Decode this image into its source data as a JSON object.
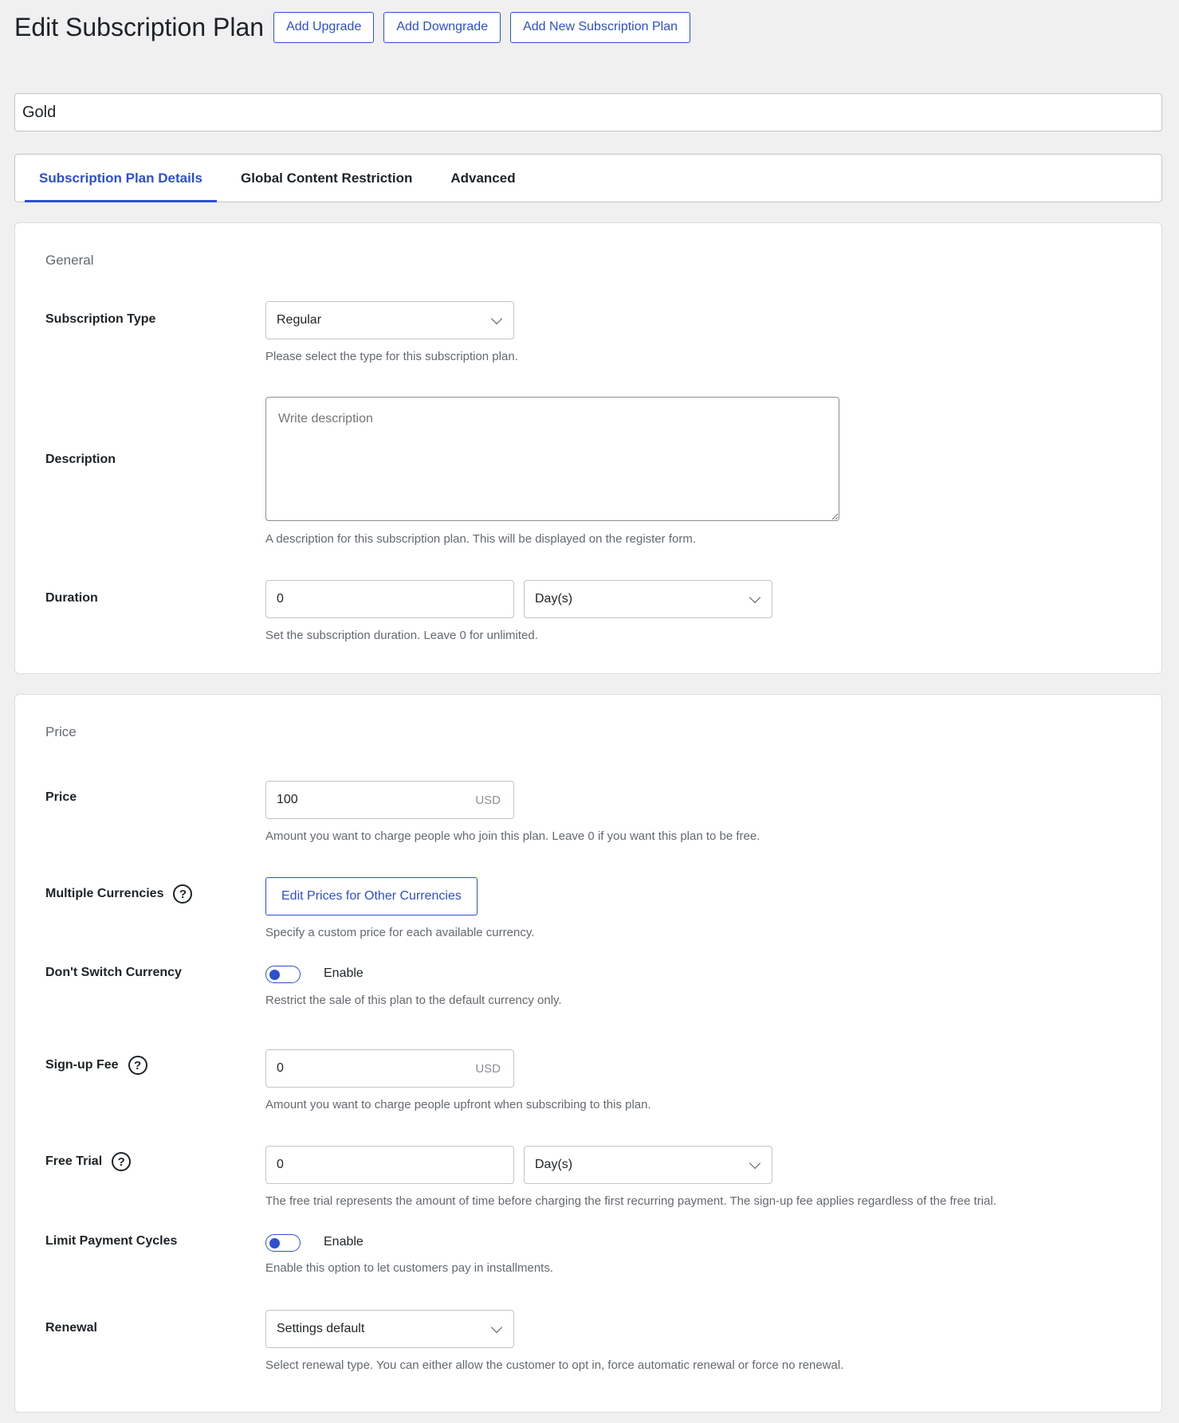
{
  "header": {
    "title": "Edit Subscription Plan",
    "buttons": [
      "Add Upgrade",
      "Add Downgrade",
      "Add New Subscription Plan"
    ]
  },
  "plan_name": "Gold",
  "tabs": [
    {
      "label": "Subscription Plan Details",
      "active": true
    },
    {
      "label": "Global Content Restriction",
      "active": false
    },
    {
      "label": "Advanced",
      "active": false
    }
  ],
  "general": {
    "section_title": "General",
    "subscription_type": {
      "label": "Subscription Type",
      "value": "Regular",
      "hint": "Please select the type for this subscription plan."
    },
    "description": {
      "label": "Description",
      "placeholder": "Write description",
      "hint": "A description for this subscription plan. This will be displayed on the register form."
    },
    "duration": {
      "label": "Duration",
      "value": "0",
      "unit": "Day(s)",
      "hint": "Set the subscription duration. Leave 0 for unlimited."
    }
  },
  "price_section": {
    "section_title": "Price",
    "price": {
      "label": "Price",
      "value": "100",
      "currency": "USD",
      "hint": "Amount you want to charge people who join this plan. Leave 0 if you want this plan to be free."
    },
    "multiple_currencies": {
      "label": "Multiple Currencies",
      "button": "Edit Prices for Other Currencies",
      "hint": "Specify a custom price for each available currency."
    },
    "dont_switch_currency": {
      "label": "Don't Switch Currency",
      "toggle_label": "Enable",
      "hint": "Restrict the sale of this plan to the default currency only."
    },
    "signup_fee": {
      "label": "Sign-up Fee",
      "value": "0",
      "currency": "USD",
      "hint": "Amount you want to charge people upfront when subscribing to this plan."
    },
    "free_trial": {
      "label": "Free Trial",
      "value": "0",
      "unit": "Day(s)",
      "hint": "The free trial represents the amount of time before charging the first recurring payment. The sign-up fee applies regardless of the free trial."
    },
    "limit_payment_cycles": {
      "label": "Limit Payment Cycles",
      "toggle_label": "Enable",
      "hint": "Enable this option to let customers pay in installments."
    },
    "renewal": {
      "label": "Renewal",
      "value": "Settings default",
      "hint": "Select renewal type. You can either allow the customer to opt in, force automatic renewal or force no renewal."
    }
  },
  "colors": {
    "accent": "#2d4fd0",
    "background": "#f0f0f1"
  },
  "icons": {
    "help": "question-circle-icon",
    "dropdown": "chevron-down-icon"
  }
}
